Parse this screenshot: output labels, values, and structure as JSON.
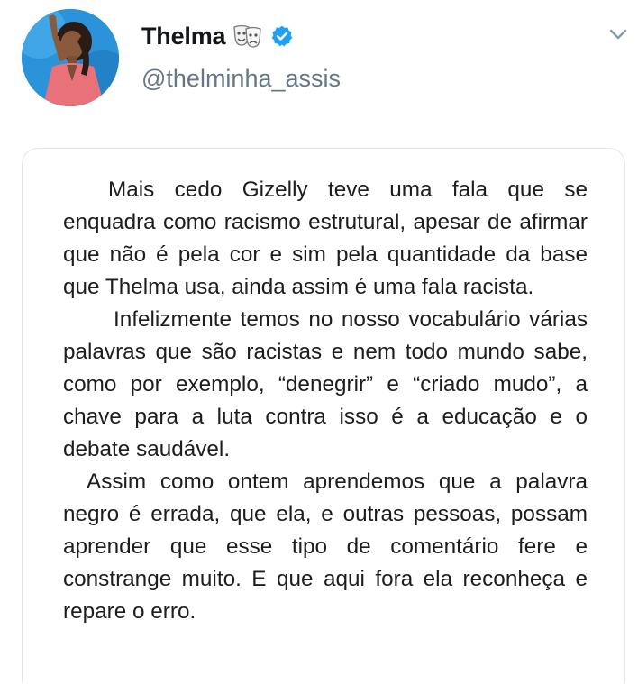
{
  "tweet": {
    "display_name": "Thelma",
    "emoji_icon": "performing-arts-icon",
    "verified_icon": "verified-badge-icon",
    "handle": "@thelminha_assis",
    "menu_icon": "chevron-down-icon",
    "accent_color": "#1da1f2"
  },
  "image_text": {
    "paragraphs": [
      "Mais cedo Gizelly teve uma fala que se enquadra como racismo estrutural, apesar de afirmar que não é pela cor e sim pela quantidade da base que Thelma usa, ainda assim é uma fala racista.",
      "Infelizmente temos no nosso vocabulário várias palavras que são racistas e nem todo mundo sabe, como por exemplo, “denegrir” e “criado mudo”, a chave para a luta contra isso é a educação e o debate saudável.",
      "Assim como ontem aprendemos que a palavra negro é errada, que ela, e outras pessoas, possam aprender que esse tipo de comentário fere e constrange muito. E que aqui fora ela reconheça e repare o erro."
    ]
  }
}
